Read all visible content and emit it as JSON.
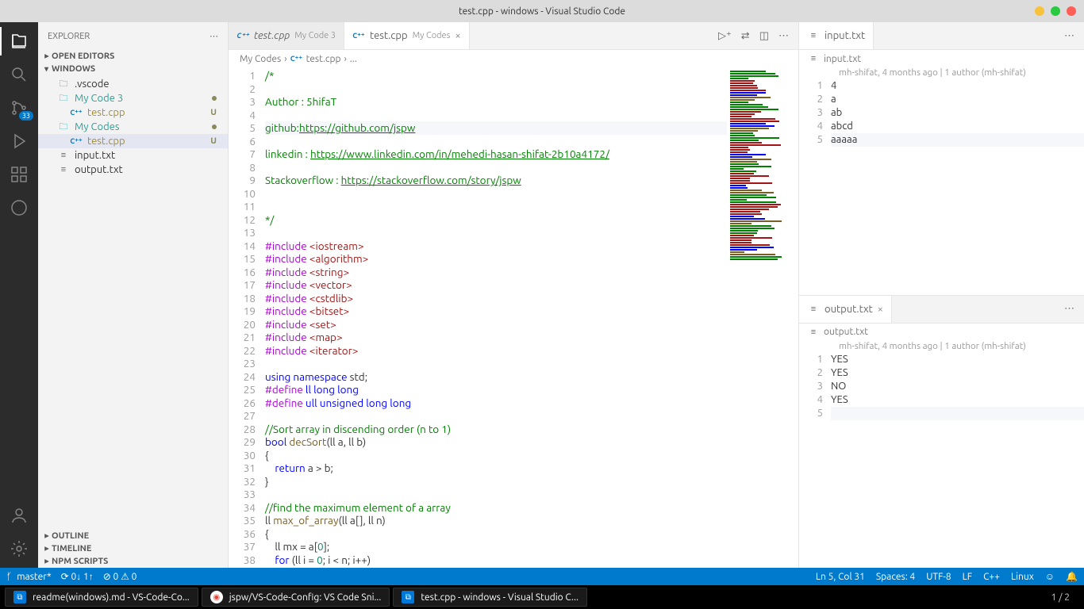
{
  "window": {
    "title": "test.cpp - windows - Visual Studio Code"
  },
  "sidebar": {
    "title": "EXPLORER",
    "sections": {
      "openEditors": "OPEN EDITORS",
      "workspace": "WINDOWS",
      "outline": "OUTLINE",
      "timeline": "TIMELINE",
      "npm": "NPM SCRIPTS"
    },
    "tree": [
      {
        "name": ".vscode",
        "icon": "folder-dark"
      },
      {
        "name": "My Code 3",
        "icon": "folder",
        "cls": "green-name",
        "dot": true
      },
      {
        "name": "test.cpp",
        "icon": "cpp",
        "cls": "olive-name",
        "status": "U",
        "nested": true
      },
      {
        "name": "My Codes",
        "icon": "folder",
        "cls": "green-name",
        "dot": true
      },
      {
        "name": "test.cpp",
        "icon": "cpp",
        "cls": "olive-name",
        "status": "U",
        "nested": true,
        "selected": true
      },
      {
        "name": "input.txt",
        "icon": "txt"
      },
      {
        "name": "output.txt",
        "icon": "txt"
      }
    ]
  },
  "tabs": {
    "main": [
      {
        "icon": "cpp",
        "name": "test.cpp",
        "desc": "My Code 3"
      },
      {
        "icon": "cpp",
        "name": "test.cpp",
        "desc": "My Codes",
        "active": true,
        "close": true
      }
    ],
    "side_top": [
      {
        "icon": "txt",
        "name": "input.txt",
        "active": true
      }
    ],
    "side_bottom": [
      {
        "icon": "txt",
        "name": "output.txt",
        "active": true,
        "close": true
      }
    ]
  },
  "breadcrumb": [
    "My Codes",
    "test.cpp",
    "..."
  ],
  "code": {
    "lines": [
      {
        "n": 1,
        "html": "<span class='tok-comment'>/*</span>"
      },
      {
        "n": 2,
        "html": ""
      },
      {
        "n": 3,
        "html": "<span class='tok-comment'>Author : 5hifaT</span>"
      },
      {
        "n": 4,
        "html": ""
      },
      {
        "n": 5,
        "html": "<span class='tok-comment'>github:</span><span class='tok-link'>https://github.com/jspw</span>",
        "current": true
      },
      {
        "n": 6,
        "html": ""
      },
      {
        "n": 7,
        "html": "<span class='tok-comment'>linkedin : </span><span class='tok-link'>https://www.linkedin.com/in/mehedi-hasan-shifat-2b10a4172/</span>"
      },
      {
        "n": 8,
        "html": ""
      },
      {
        "n": 9,
        "html": "<span class='tok-comment'>Stackoverflow : </span><span class='tok-link'>https://stackoverflow.com/story/jspw</span>"
      },
      {
        "n": 10,
        "html": ""
      },
      {
        "n": 11,
        "html": ""
      },
      {
        "n": 12,
        "html": "<span class='tok-comment'>*/</span>"
      },
      {
        "n": 13,
        "html": ""
      },
      {
        "n": 14,
        "html": "<span class='tok-include'>#include</span> <span class='tok-string'>&lt;iostream&gt;</span>"
      },
      {
        "n": 15,
        "html": "<span class='tok-include'>#include</span> <span class='tok-string'>&lt;algorithm&gt;</span>"
      },
      {
        "n": 16,
        "html": "<span class='tok-include'>#include</span> <span class='tok-string'>&lt;string&gt;</span>"
      },
      {
        "n": 17,
        "html": "<span class='tok-include'>#include</span> <span class='tok-string'>&lt;vector&gt;</span>"
      },
      {
        "n": 18,
        "html": "<span class='tok-include'>#include</span> <span class='tok-string'>&lt;cstdlib&gt;</span>"
      },
      {
        "n": 19,
        "html": "<span class='tok-include'>#include</span> <span class='tok-string'>&lt;bitset&gt;</span>"
      },
      {
        "n": 20,
        "html": "<span class='tok-include'>#include</span> <span class='tok-string'>&lt;set&gt;</span>"
      },
      {
        "n": 21,
        "html": "<span class='tok-include'>#include</span> <span class='tok-string'>&lt;map&gt;</span>"
      },
      {
        "n": 22,
        "html": "<span class='tok-include'>#include</span> <span class='tok-string'>&lt;iterator&gt;</span>"
      },
      {
        "n": 23,
        "html": ""
      },
      {
        "n": 24,
        "html": "<span class='tok-keyword'>using</span> <span class='tok-keyword'>namespace</span> std;"
      },
      {
        "n": 25,
        "html": "<span class='tok-include'>#define</span> <span class='tok-keyword'>ll long long</span>"
      },
      {
        "n": 26,
        "html": "<span class='tok-include'>#define</span> <span class='tok-keyword'>ull unsigned long long</span>"
      },
      {
        "n": 27,
        "html": ""
      },
      {
        "n": 28,
        "html": "<span class='tok-comment'>//Sort array in discending order (n to 1)</span>"
      },
      {
        "n": 29,
        "html": "<span class='tok-type'>bool</span> <span class='tok-func'>decSort</span>(ll a, ll b)"
      },
      {
        "n": 30,
        "html": "{"
      },
      {
        "n": 31,
        "html": "    <span class='tok-keyword'>return</span> a &gt; b;"
      },
      {
        "n": 32,
        "html": "}"
      },
      {
        "n": 33,
        "html": ""
      },
      {
        "n": 34,
        "html": "<span class='tok-comment'>//find the maximum element of a array</span>"
      },
      {
        "n": 35,
        "html": "ll <span class='tok-func'>max_of_array</span>(ll a[], ll n)"
      },
      {
        "n": 36,
        "html": "{"
      },
      {
        "n": 37,
        "html": "    ll mx = a[<span class='tok-num'>0</span>];"
      },
      {
        "n": 38,
        "html": "    <span class='tok-keyword'>for</span> (ll i = <span class='tok-num'>0</span>; i &lt; n; i++)"
      }
    ]
  },
  "input": {
    "name": "input.txt",
    "meta": "mh-shifat, 4 months ago | 1 author (mh-shifat)",
    "lines": [
      "4",
      "a",
      "ab",
      "abcd",
      "aaaaa"
    ]
  },
  "output": {
    "name": "output.txt",
    "meta": "mh-shifat, 4 months ago | 1 author (mh-shifat)",
    "lines": [
      "YES",
      "YES",
      "NO",
      "YES",
      ""
    ]
  },
  "statusbar": {
    "branch": "master*",
    "sync": "⟳ 0↓ 1↑",
    "problems": "⊘ 0  ⚠ 0",
    "position": "Ln 5, Col 31",
    "spaces": "Spaces: 4",
    "encoding": "UTF-8",
    "eol": "LF",
    "lang": "C++",
    "os": "Linux"
  },
  "scm_badge": "33",
  "taskbar": {
    "items": [
      {
        "icon": "vscode",
        "label": "readme(windows).md - VS-Code-Co..."
      },
      {
        "icon": "chrome",
        "label": "jspw/VS-Code-Config: VS Code Sni..."
      },
      {
        "icon": "vscode",
        "label": "test.cpp - windows - Visual Studio C..."
      }
    ],
    "right": "1 / 2"
  }
}
